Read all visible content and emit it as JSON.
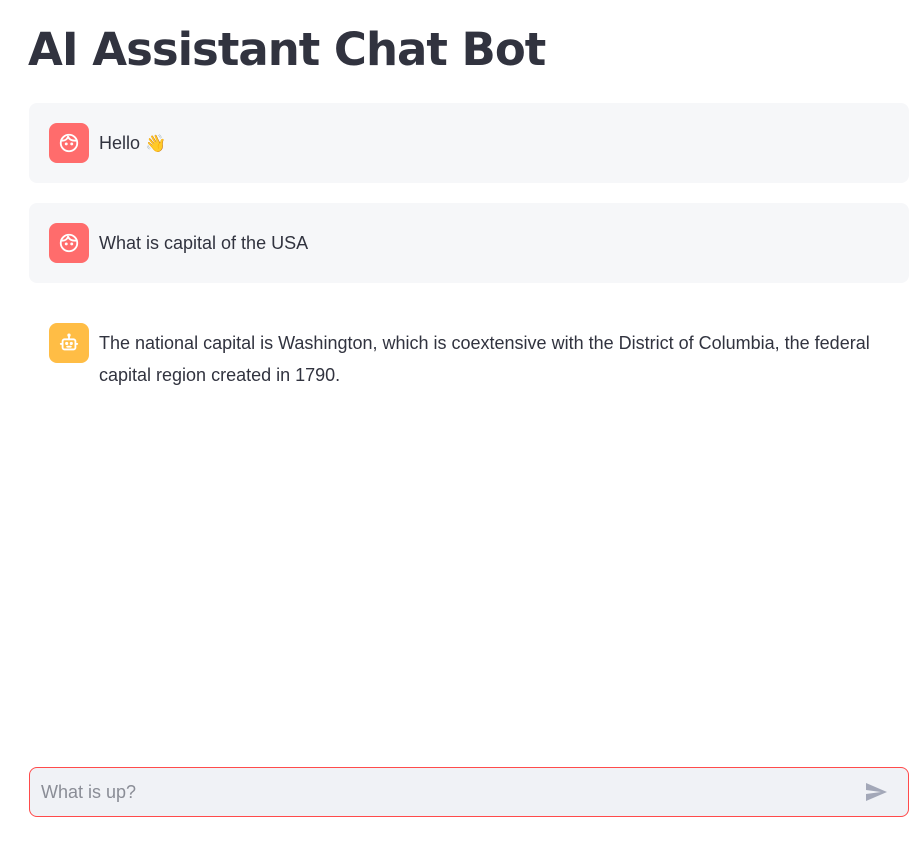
{
  "page": {
    "title": "AI Assistant Chat Bot"
  },
  "messages": [
    {
      "role": "user",
      "text": "Hello",
      "emoji": "👋",
      "avatar_icon": "user-face-icon"
    },
    {
      "role": "user",
      "text": "What is capital of the USA",
      "avatar_icon": "user-face-icon"
    },
    {
      "role": "assistant",
      "text": "The national capital is Washington, which is coextensive with the District of Columbia, the federal capital region created in 1790.",
      "avatar_icon": "robot-icon"
    }
  ],
  "chat_input": {
    "placeholder": "What is up?",
    "value": "",
    "send_icon": "send-icon"
  },
  "colors": {
    "user_avatar": "#ff6c6c",
    "assistant_avatar": "#ffbd45",
    "message_bg": "#f6f7f9",
    "input_border": "#ff4b4b",
    "input_bg": "#f0f2f6",
    "text": "#31333f"
  }
}
